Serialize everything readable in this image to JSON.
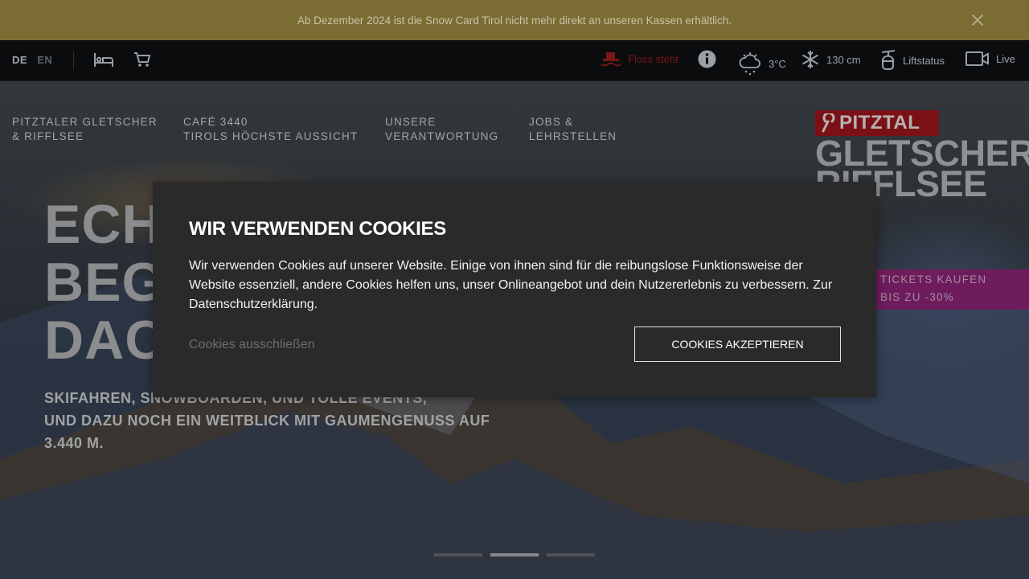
{
  "banner": {
    "text": "Ab Dezember 2024 ist die Snow Card Tirol nicht mehr direkt an unseren Kassen erhältlich."
  },
  "topbar": {
    "lang_de": "DE",
    "lang_en": "EN",
    "floss_status": "Floss steht",
    "temperature": "3°C",
    "snow_depth": "130 cm",
    "liftstatus": "Liftstatus",
    "live": "Live"
  },
  "nav": [
    {
      "line1": "PITZTALER GLETSCHER",
      "line2": "& RIFFLSEE"
    },
    {
      "line1": "CAFÉ 3440",
      "line2": "TIROLS HÖCHSTE AUSSICHT"
    },
    {
      "line1": "UNSERE",
      "line2": "VERANTWORTUNG"
    },
    {
      "line1": "JOBS &",
      "line2": "LEHRSTELLEN"
    }
  ],
  "logo": {
    "badge": "PITZTAL",
    "line1": "GLETSCHER",
    "line2": "RIFFLSEE"
  },
  "hero": {
    "headline_l1": "ECH",
    "headline_l2": "BEG",
    "headline_l3": "DAC",
    "subline_l1": "SKIFAHREN, SNOWBOARDEN, UND TOLLE EVENTS,",
    "subline_l2": "UND DAZU NOCH EIN WEITBLICK MIT GAUMENGENUSS AUF",
    "subline_l3": "3.440 M."
  },
  "ticket": {
    "line1": "TICKETS KAUFEN",
    "line2": "BIS ZU -30%"
  },
  "slider": {
    "active_index": 1,
    "count": 3
  },
  "cookie": {
    "title": "WIR VERWENDEN COOKIES",
    "text": "Wir verwenden Cookies auf unserer Website. Einige von ihnen sind für die reibungslose Funktionsweise der Website essenziell, andere Cookies helfen uns, unser Onlineangebot und dein Nutzererlebnis zu verbessern. Zur Datenschutzerklärung.",
    "deny": "Cookies ausschließen",
    "accept": "COOKIES AKZEPTIEREN"
  },
  "colors": {
    "banner": "#7b6c33",
    "ticket": "#6e1c5c",
    "logo_badge": "#7b1116",
    "floss": "#7a1818"
  }
}
